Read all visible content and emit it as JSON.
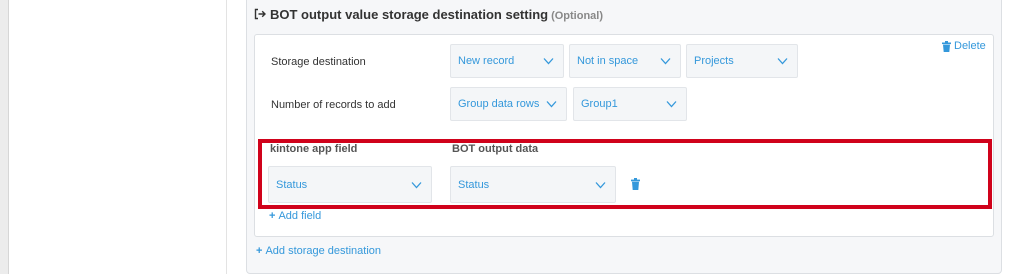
{
  "section": {
    "title": "BOT output value storage destination setting",
    "optional_label": "(Optional)",
    "delete_label": "Delete"
  },
  "storage_destination": {
    "label": "Storage destination",
    "record_type": "New record",
    "space": "Not in space",
    "app": "Projects"
  },
  "records_to_add": {
    "label": "Number of records to add",
    "source": "Group data rows",
    "group": "Group1"
  },
  "field_mapping": {
    "kintone_header": "kintone app field",
    "bot_header": "BOT output data",
    "rows": [
      {
        "kintone_field": "Status",
        "bot_data": "Status"
      }
    ],
    "add_field_label": "Add field"
  },
  "add_destination_label": "Add storage destination",
  "colors": {
    "accent": "#3498db",
    "highlight": "#d0021b",
    "panel_bg": "#f6f7f9",
    "dropdown_bg": "#f4f6f8"
  },
  "icons": [
    "arrow-right-bracket-icon",
    "trash-icon",
    "chevron-down-icon",
    "plus-icon"
  ]
}
